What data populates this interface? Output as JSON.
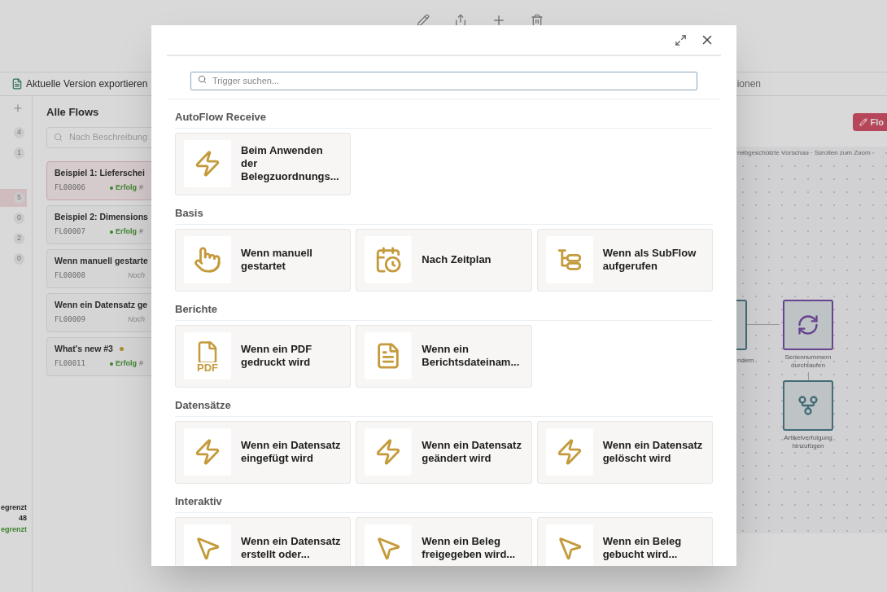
{
  "toolbar": {
    "export_label": "Aktuelle Version exportieren",
    "right_label": "ionen"
  },
  "rail": {
    "counts": [
      {
        "count": "4",
        "selected": false
      },
      {
        "count": "1",
        "selected": false
      },
      {
        "count": "5",
        "selected": true
      },
      {
        "count": "0",
        "selected": false
      },
      {
        "count": "2",
        "selected": false
      },
      {
        "count": "0",
        "selected": false
      }
    ],
    "footer": [
      {
        "text": "egrenzt",
        "kind": "plain"
      },
      {
        "text": "48",
        "kind": "plain"
      },
      {
        "text": "egrenzt",
        "kind": "success"
      }
    ]
  },
  "flows": {
    "title": "Alle Flows",
    "search_placeholder": "Nach Beschreibung",
    "items": [
      {
        "name": "Beispiel 1: Lieferschei",
        "id": "FL00006",
        "status": "Erfolg",
        "kind": "success",
        "hash": "#",
        "selected": true
      },
      {
        "name": "Beispiel 2: Dimensions",
        "id": "FL00007",
        "status": "Erfolg",
        "kind": "success",
        "hash": "#",
        "selected": false
      },
      {
        "name": "Wenn manuell gestarte",
        "id": "FL00008",
        "status": "Noch",
        "kind": "pending",
        "selected": false
      },
      {
        "name": "Wenn ein Datensatz ge",
        "id": "FL00009",
        "status": "Noch",
        "kind": "pending",
        "selected": false
      },
      {
        "name": "What's new #3",
        "id": "FL00011",
        "status": "Erfolg",
        "kind": "success",
        "hash": "#",
        "selected": false,
        "color": "#ab8b31"
      }
    ]
  },
  "editor": {
    "edit_button": "Flo",
    "hint": "reibgeschützte Vorschau · Scrollen zum Zoom",
    "nodes": [
      {
        "label": "ndern",
        "kind": "partial",
        "color": "#436c77"
      },
      {
        "label": "Seriennummern durchlaufen",
        "kind": "loop",
        "color": "#68438f"
      },
      {
        "label": "Artikelverfolgung hinzufügen",
        "kind": "branch",
        "color": "#436c77"
      }
    ]
  },
  "dialog": {
    "search_placeholder": "Trigger suchen...",
    "sections": [
      {
        "title": "AutoFlow Receive",
        "triggers": [
          {
            "label": "Beim Anwenden der Belegzuordnungs...",
            "kind": "bolt"
          }
        ]
      },
      {
        "title": "Basis",
        "triggers": [
          {
            "label": "Wenn manuell gestartet",
            "kind": "hand"
          },
          {
            "label": "Nach Zeitplan",
            "kind": "calendar"
          },
          {
            "label": "Wenn als SubFlow aufgerufen",
            "kind": "tree"
          }
        ]
      },
      {
        "title": "Berichte",
        "triggers": [
          {
            "label": "Wenn ein PDF gedruckt wird",
            "kind": "pdf",
            "icon_text": "PDF"
          },
          {
            "label": "Wenn ein Berichtsdateinam...",
            "kind": "document"
          }
        ]
      },
      {
        "title": "Datensätze",
        "triggers": [
          {
            "label": "Wenn ein Datensatz eingefügt wird",
            "kind": "bolt"
          },
          {
            "label": "Wenn ein Datensatz geändert wird",
            "kind": "bolt"
          },
          {
            "label": "Wenn ein Datensatz gelöscht wird",
            "kind": "bolt"
          }
        ]
      },
      {
        "title": "Interaktiv",
        "triggers": [
          {
            "label": "Wenn ein Datensatz erstellt oder...",
            "kind": "cursor"
          },
          {
            "label": "Wenn ein Beleg freigegeben wird...",
            "kind": "cursor"
          },
          {
            "label": "Wenn ein Beleg gebucht wird...",
            "kind": "cursor"
          }
        ]
      }
    ]
  }
}
